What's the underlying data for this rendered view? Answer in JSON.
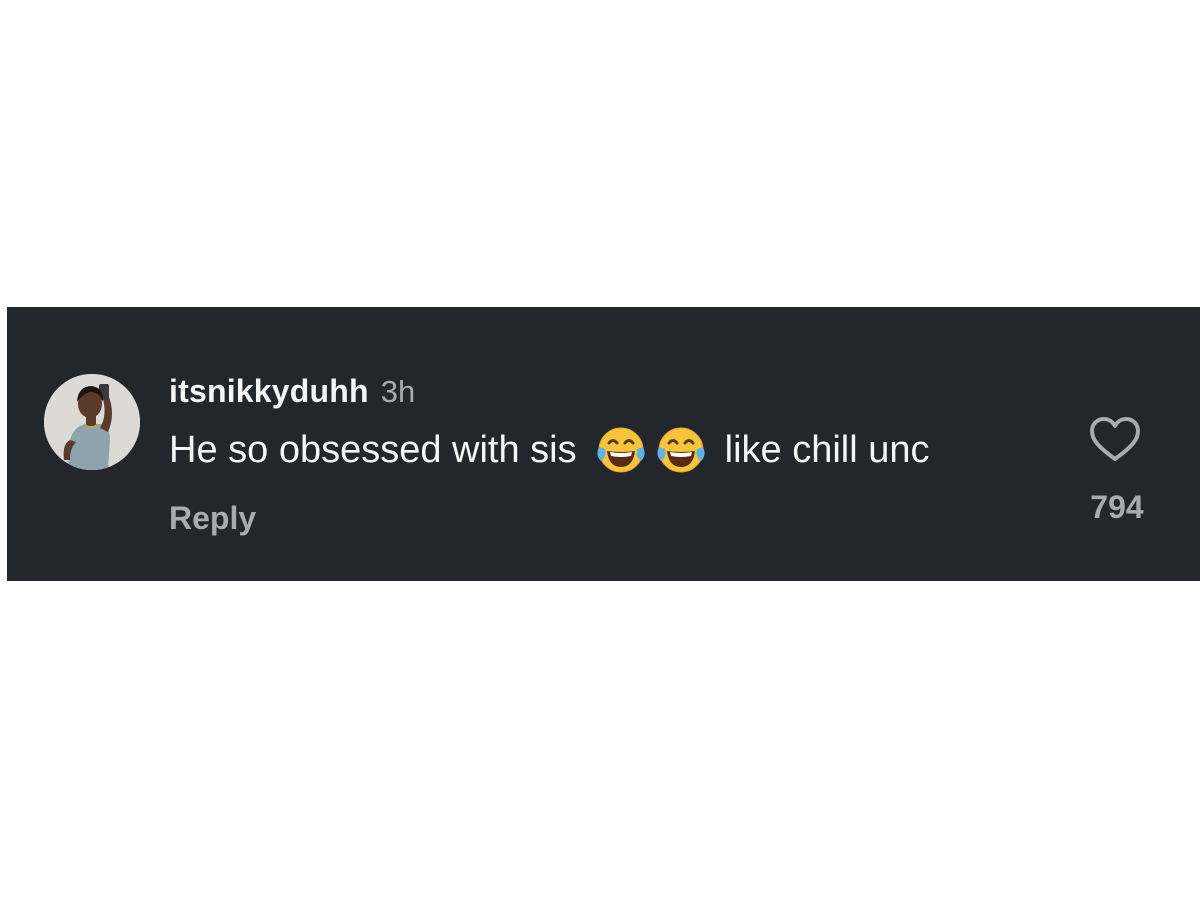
{
  "comment": {
    "username": "itsnikkyduhh",
    "timestamp": "3h",
    "text_before_emoji": "He so obsessed with sis",
    "emojis": [
      "face-with-tears-of-joy-icon",
      "face-with-tears-of-joy-icon"
    ],
    "text_after_emoji": "like chill unc",
    "reply_label": "Reply",
    "like_count": "794"
  },
  "colors": {
    "card_background": "#23262b",
    "primary_text": "#f5f5f5",
    "secondary_text": "#a8abb0",
    "page_background": "#ffffff"
  },
  "icons": {
    "like": "heart-outline-icon",
    "avatar": "user-avatar"
  }
}
